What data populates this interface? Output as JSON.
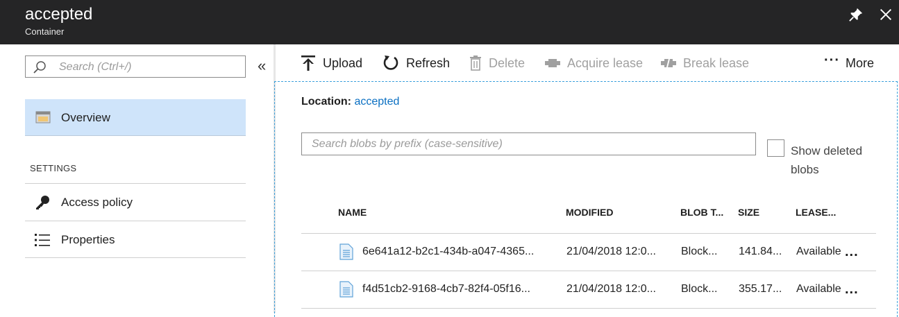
{
  "header": {
    "title": "accepted",
    "subtitle": "Container"
  },
  "sidebar": {
    "search_placeholder": "Search (Ctrl+/)",
    "collapse_glyph": "«",
    "items": [
      {
        "label": "Overview",
        "icon": "overview-icon",
        "selected": true
      }
    ],
    "section_header": "SETTINGS",
    "settings_items": [
      {
        "label": "Access policy",
        "icon": "key-icon"
      },
      {
        "label": "Properties",
        "icon": "list-icon"
      }
    ]
  },
  "toolbar": {
    "upload": "Upload",
    "refresh": "Refresh",
    "delete": "Delete",
    "acquire_lease": "Acquire lease",
    "break_lease": "Break lease",
    "more": "More"
  },
  "location": {
    "label": "Location:",
    "value": "accepted"
  },
  "blob_search": {
    "placeholder": "Search blobs by prefix (case-sensitive)"
  },
  "show_deleted": {
    "label": "Show deleted blobs",
    "checked": false
  },
  "table": {
    "columns": [
      "NAME",
      "MODIFIED",
      "BLOB T...",
      "SIZE",
      "LEASE..."
    ],
    "rows": [
      {
        "name": "6e641a12-b2c1-434b-a047-4365...",
        "modified": "21/04/2018 12:0...",
        "type": "Block...",
        "size": "141.84...",
        "lease": "Available"
      },
      {
        "name": "f4d51cb2-9168-4cb7-82f4-05f16...",
        "modified": "21/04/2018 12:0...",
        "type": "Block...",
        "size": "355.17...",
        "lease": "Available"
      }
    ],
    "row_more": "..."
  },
  "colors": {
    "titlebar": "#252526",
    "selected_nav": "#cfe4fa",
    "link": "#0a6fc2",
    "focus_border": "#3aa0dc"
  }
}
